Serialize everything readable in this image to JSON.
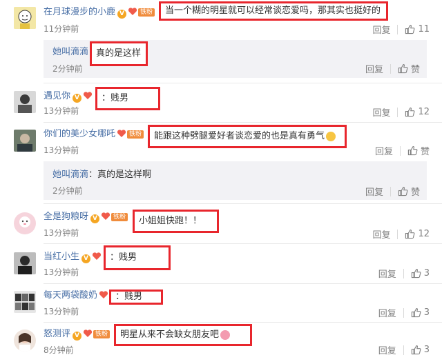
{
  "comments": [
    {
      "username": "在月球漫步的小鹿",
      "badges": [
        "V",
        "heart",
        "铁粉"
      ],
      "text": "当一个糊的明星就可以经常谈恋爱吗，那其实也挺好的",
      "time": "11分钟前",
      "reply_label": "回复",
      "like_count": "11",
      "replies": [
        {
          "username": "她叫滴滴",
          "colon": "：",
          "text": "真的是这样",
          "time": "2分钟前",
          "reply_label": "回复",
          "like_label": "赞"
        }
      ]
    },
    {
      "username": "遇见你",
      "badges": [
        "V",
        "heart"
      ],
      "text": "：贱男",
      "time": "13分钟前",
      "reply_label": "回复",
      "like_count": "12"
    },
    {
      "username": "你们的美少女哪吒",
      "badges": [
        "heart",
        "铁粉"
      ],
      "text": "能跟这种劈腿爱好者谈恋爱的也是真有勇气",
      "time": "13分钟前",
      "reply_label": "回复",
      "like_label": "赞",
      "replies": [
        {
          "username": "她叫滴滴",
          "colon": "：",
          "text": "真的是这样啊",
          "time": "2分钟前",
          "reply_label": "回复",
          "like_label": "赞"
        }
      ]
    },
    {
      "username": "全是狗粮呀",
      "badges": [
        "V",
        "heart",
        "铁粉"
      ],
      "text": "小姐姐快跑！！",
      "time": "13分钟前",
      "reply_label": "回复",
      "like_count": "12"
    },
    {
      "username": "当红小生",
      "badges": [
        "V",
        "heart"
      ],
      "text": "：贱男",
      "time": "13分钟前",
      "reply_label": "回复",
      "like_count": "3"
    },
    {
      "username": "每天两袋酸奶",
      "badges": [
        "heart"
      ],
      "text": "：贱男",
      "time": "13分钟前",
      "reply_label": "回复",
      "like_count": "3"
    },
    {
      "username": "怒测评",
      "badges": [
        "V",
        "heart",
        "铁粉"
      ],
      "text": "明星从来不会缺女朋友吧",
      "time": "8分钟前",
      "reply_label": "回复",
      "like_count": "3"
    }
  ],
  "colors": {
    "username": "#476ea5",
    "highlight_border": "#e8262d",
    "meta": "#808080",
    "reply_bg": "#f2f2f5"
  }
}
